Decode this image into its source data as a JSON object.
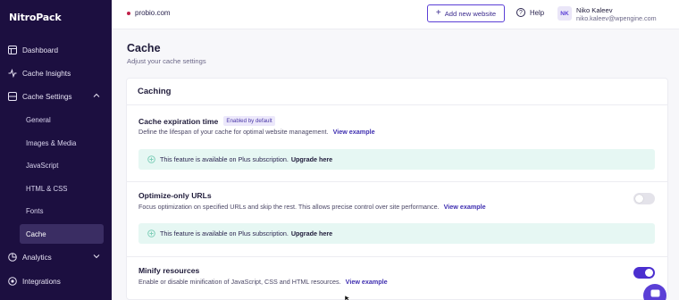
{
  "brand": {
    "logo_text": "NitroPack"
  },
  "sidebar": {
    "items": [
      {
        "label": "Dashboard",
        "icon": "dashboard-icon"
      },
      {
        "label": "Cache Insights",
        "icon": "insights-icon"
      },
      {
        "label": "Cache Settings",
        "icon": "cache-settings-icon"
      },
      {
        "label": "Analytics",
        "icon": "analytics-icon"
      },
      {
        "label": "Integrations",
        "icon": "integrations-icon"
      }
    ],
    "sub_items": [
      "General",
      "Images & Media",
      "JavaScript",
      "HTML & CSS",
      "Fonts",
      "Cache"
    ],
    "active_sub_item": "Cache"
  },
  "topbar": {
    "domain": "probio.com",
    "add_website_label": "Add new website",
    "help_label": "Help",
    "user": {
      "initials": "NK",
      "name": "Niko Kaleev",
      "email": "niko.kaleev@wpengine.com"
    }
  },
  "page": {
    "title": "Cache",
    "subtitle": "Adjust your cache settings"
  },
  "caching": {
    "title": "Caching",
    "rows": [
      {
        "title": "Cache expiration time",
        "badge": "Enabled by default",
        "description": "Define the lifespan of your cache for optimal website management.",
        "link": "View example",
        "notice": "This feature is available on Plus subscription.",
        "notice_link": "Upgrade here"
      },
      {
        "title": "Optimize-only URLs",
        "description": "Focus optimization on specified URLs and skip the rest. This allows precise control over site performance.",
        "link": "View example",
        "toggle": "off",
        "notice": "This feature is available on Plus subscription.",
        "notice_link": "Upgrade here"
      },
      {
        "title": "Minify resources",
        "description": "Enable or disable minification of JavaScript, CSS and HTML resources.",
        "link": "View example",
        "toggle": "on"
      }
    ]
  },
  "colors": {
    "sidebar_bg": "#1c0f40",
    "accent": "#4b2fcf",
    "notice_bg": "#e6f7f3"
  }
}
